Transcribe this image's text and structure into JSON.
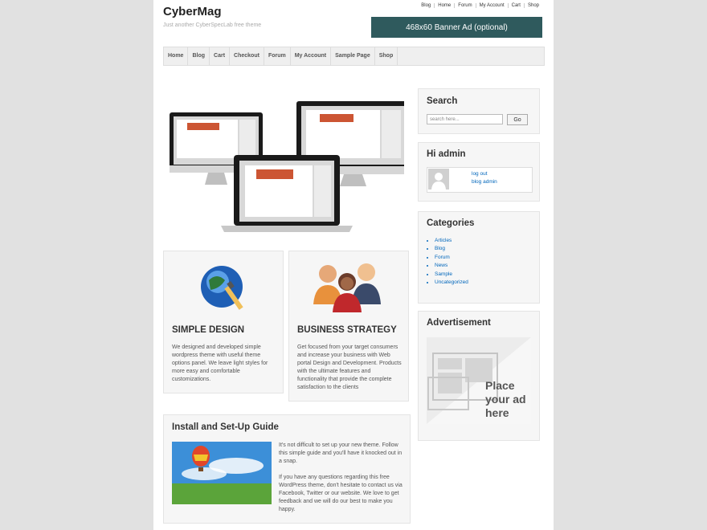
{
  "site": {
    "title": "CyberMag",
    "tagline": "Just another CyberSpecLab free theme"
  },
  "top_nav": [
    "Blog",
    "Home",
    "Forum",
    "My Account",
    "Cart",
    "Shop"
  ],
  "banner": "468x60 Banner Ad (optional)",
  "main_nav": [
    "Home",
    "Blog",
    "Cart",
    "Checkout",
    "Forum",
    "My Account",
    "Sample Page",
    "Shop"
  ],
  "features": [
    {
      "title": "SIMPLE DESIGN",
      "text": "We designed and developed simple wordpress theme with useful theme options panel. We leave light styles for more easy and comfortable customizations."
    },
    {
      "title": "BUSINESS STRATEGY",
      "text": "Get focused from your target consumers and increase your business with Web portal Design and Development. Products with the ultimate features and functionality that provide the complete satisfaction to the clients"
    }
  ],
  "guide": {
    "title": "Install and Set-Up Guide",
    "para1": "It's not difficult to set up your new theme. Follow this simple guide and you'll have it knocked out in a snap.",
    "para2": "If you have any questions regarding this free WordPress theme, don't hesitate to contact us via Facebook, Twitter or our website. We love to get feedback and we will do our best to make you happy."
  },
  "sidebar": {
    "search": {
      "title": "Search",
      "placeholder": "search here...",
      "button": "Go"
    },
    "user": {
      "title": "Hi admin",
      "logout": "log out",
      "blog_admin": "blog admin"
    },
    "categories": {
      "title": "Categories",
      "items": [
        "Articles",
        "Blog",
        "Forum",
        "News",
        "Sample",
        "Uncategorized"
      ]
    },
    "ad": {
      "title": "Advertisement",
      "text": "Place your ad here"
    }
  }
}
